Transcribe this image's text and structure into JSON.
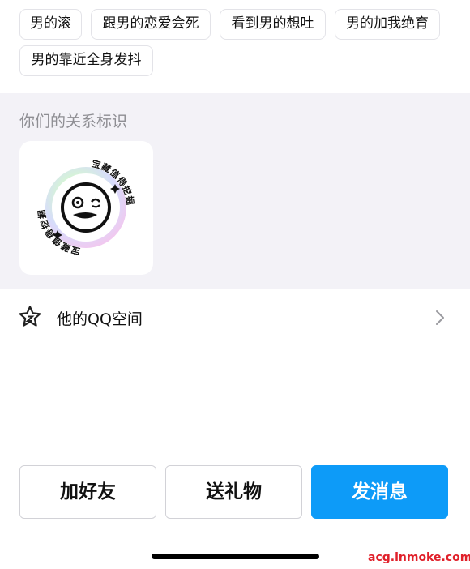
{
  "tags": [
    "男的滚",
    "跟男的恋爱会死",
    "看到男的想吐",
    "男的加我绝育",
    "男的靠近全身发抖"
  ],
  "relation": {
    "title": "你们的关系标识",
    "badge": {
      "ring_text": "宝藏值得挖掘"
    }
  },
  "qzone": {
    "label": "他的QQ空间"
  },
  "actions": {
    "add_friend": "加好友",
    "send_gift": "送礼物",
    "send_message": "发消息"
  },
  "colors": {
    "primary": "#0d9bf8",
    "section_bg": "#f3f2f7",
    "watermark": "#e0202a"
  },
  "watermark": "acg.inmoke.com",
  "icons": {
    "qzone": "star-icon",
    "chevron": "chevron-right-icon"
  }
}
